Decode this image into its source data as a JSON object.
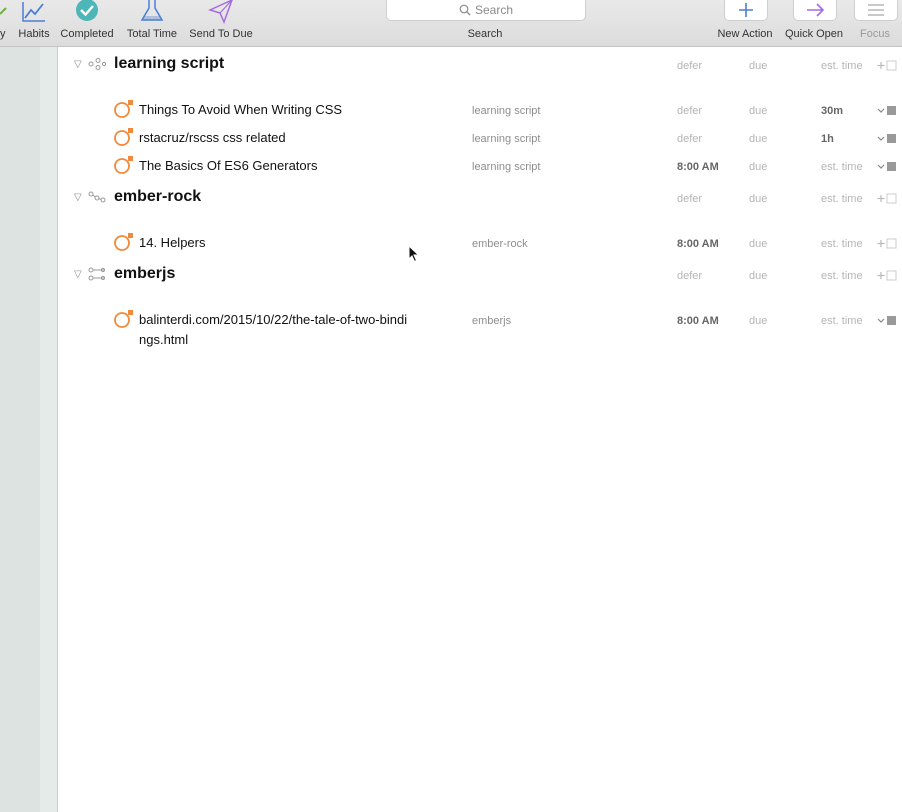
{
  "toolbar": {
    "items": [
      {
        "label": "y",
        "icon": "partial-icon"
      },
      {
        "label": "Habits",
        "icon": "chart-line-icon"
      },
      {
        "label": "Completed",
        "icon": "check-circle-icon"
      },
      {
        "label": "Total Time",
        "icon": "flask-icon"
      },
      {
        "label": "Send To Due",
        "icon": "paper-plane-icon"
      }
    ],
    "search_placeholder": "Search",
    "search_label": "Search",
    "right": [
      {
        "label": "New Action",
        "icon": "plus-icon"
      },
      {
        "label": "Quick Open",
        "icon": "arrow-right-icon"
      },
      {
        "label": "Focus",
        "icon": "list-icon"
      }
    ]
  },
  "colors": {
    "accent_orange": "#f08a3c",
    "purple": "#a76be0",
    "teal": "#4db6b8",
    "blue": "#4a7fd4"
  },
  "projects": [
    {
      "title": "learning script",
      "defer": "defer",
      "due": "due",
      "est": "est. time",
      "tasks": [
        {
          "title": "Things To Avoid When Writing CSS",
          "project": "learning script",
          "defer": "defer",
          "due": "due",
          "est": "30m"
        },
        {
          "title": "rstacruz/rscss  css related",
          "project": "learning script",
          "defer": "defer",
          "due": "due",
          "est": "1h"
        },
        {
          "title": "The Basics Of ES6 Generators",
          "project": "learning script",
          "defer": "8:00 AM",
          "due": "due",
          "est": "est. time"
        }
      ]
    },
    {
      "title": "ember-rock",
      "defer": "defer",
      "due": "due",
      "est": "est. time",
      "tasks": [
        {
          "title": "14. Helpers",
          "project": "ember-rock",
          "defer": "8:00 AM",
          "due": "due",
          "est": "est. time"
        }
      ]
    },
    {
      "title": "emberjs",
      "defer": "defer",
      "due": "due",
      "est": "est. time",
      "tasks": [
        {
          "title": "balinterdi.com/2015/10/22/the-tale-of-two-bindings.html",
          "project": "emberjs",
          "defer": "8:00 AM",
          "due": "due",
          "est": "est. time"
        }
      ]
    }
  ]
}
